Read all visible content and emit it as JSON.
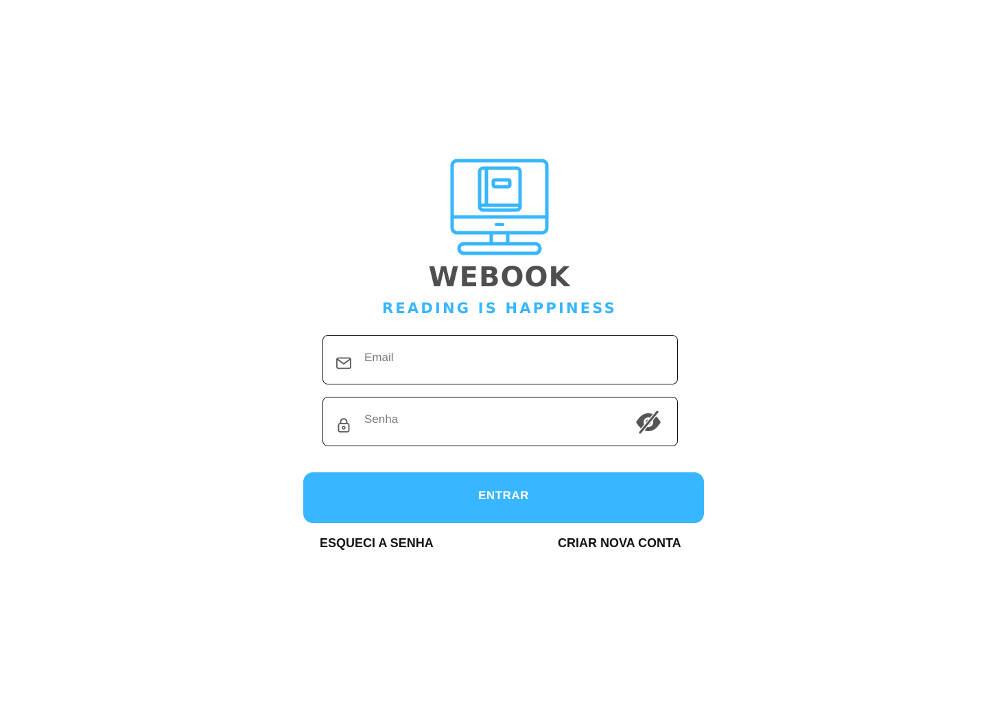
{
  "brand": {
    "name": "WEBOOK",
    "tagline": "READING IS HAPPINESS",
    "logo_icon": "monitor-book-icon"
  },
  "form": {
    "email": {
      "placeholder": "Email",
      "value": "",
      "icon": "mail-icon"
    },
    "password": {
      "placeholder": "Senha",
      "value": "",
      "icon": "lock-icon",
      "toggle_icon": "eye-off-icon"
    },
    "submit_label": "ENTRAR"
  },
  "links": {
    "forgot_password": "ESQUECI A SENHA",
    "create_account": "CRIAR NOVA CONTA"
  },
  "colors": {
    "accent": "#38b6ff",
    "brand_text": "#4f4f4f",
    "background": "#ffffff",
    "border": "#111111"
  }
}
